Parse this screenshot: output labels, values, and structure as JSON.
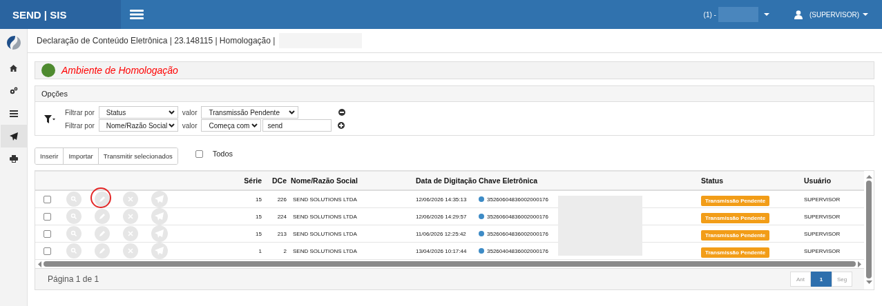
{
  "topbar": {
    "brand": "SEND | SIS",
    "company": "(1) -",
    "user": "(SUPERVISOR)"
  },
  "sidebar": {
    "items": [
      {
        "kind": "home",
        "selected": false
      },
      {
        "kind": "gears",
        "selected": false
      },
      {
        "kind": "list",
        "selected": false
      },
      {
        "kind": "send",
        "selected": true
      },
      {
        "kind": "print",
        "selected": false
      }
    ]
  },
  "breadcrumb": "Declaração de Conteúdo Eletrônica | 23.148115 | Homologação |",
  "environment": {
    "label": "Ambiente de Homologação",
    "color": "#4e8a2f"
  },
  "options": {
    "title": "Opções",
    "filters": [
      {
        "label": "Filtrar por",
        "field": "Status",
        "value_label": "valor",
        "operator": "Transmissão Pendente",
        "kind": "remove"
      },
      {
        "label": "Filtrar por",
        "field": "Nome/Razão Social",
        "value_label": "valor",
        "operator": "Começa com",
        "value": "send",
        "kind": "add"
      }
    ]
  },
  "toolbar": {
    "buttons": [
      "Inserir",
      "Importar",
      "Transmitir selecionados"
    ],
    "select_all": {
      "label": "Todos",
      "checked": false
    }
  },
  "table": {
    "columns": [
      "Série",
      "DCe",
      "Nome/Razão Social",
      "Data de Digitação",
      "Chave Eletrônica",
      "Status",
      "Usuário"
    ],
    "rows": [
      {
        "checked": false,
        "edit_highlighted": true,
        "serie": "15",
        "dce": "226",
        "name": "SEND SOLUTIONS LTDA",
        "date": "12/06/2026 14:35:13",
        "key": "35260604836002000176",
        "status": "Transmissão Pendente",
        "user": "SUPERVISOR"
      },
      {
        "checked": false,
        "edit_highlighted": false,
        "serie": "15",
        "dce": "224",
        "name": "SEND SOLUTIONS LTDA",
        "date": "12/06/2026 14:29:57",
        "key": "35260604836002000176",
        "status": "Transmissão Pendente",
        "user": "SUPERVISOR"
      },
      {
        "checked": false,
        "edit_highlighted": false,
        "serie": "15",
        "dce": "213",
        "name": "SEND SOLUTIONS LTDA",
        "date": "11/06/2026 12:25:42",
        "key": "35260604836002000176",
        "status": "Transmissão Pendente",
        "user": "SUPERVISOR"
      },
      {
        "checked": false,
        "edit_highlighted": false,
        "serie": "1",
        "dce": "2",
        "name": "SEND SOLUTIONS LTDA",
        "date": "13/04/2026 10:17:44",
        "key": "35260404836002000176",
        "status": "Transmissão Pendente",
        "user": "SUPERVISOR"
      }
    ]
  },
  "pager": {
    "info": "Página 1 de 1",
    "buttons": [
      {
        "label": "Ant",
        "selected": false
      },
      {
        "label": "1",
        "selected": true
      },
      {
        "label": "Seg",
        "selected": false
      }
    ]
  }
}
